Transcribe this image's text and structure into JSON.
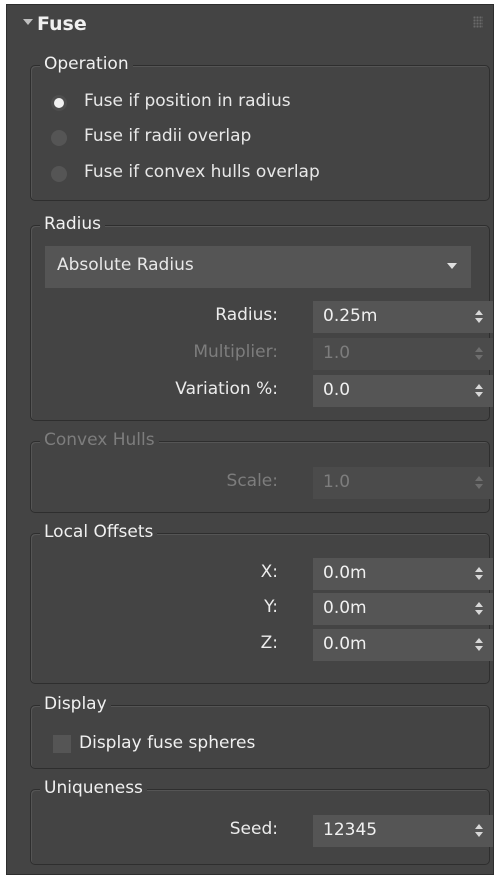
{
  "rollout": {
    "title": "Fuse"
  },
  "operation": {
    "title": "Operation",
    "options": [
      {
        "label": "Fuse if position in radius",
        "selected": true
      },
      {
        "label": "Fuse if radii overlap",
        "selected": false
      },
      {
        "label": "Fuse if convex hulls overlap",
        "selected": false
      }
    ]
  },
  "radius_group": {
    "title": "Radius",
    "mode": "Absolute Radius",
    "radius_label": "Radius:",
    "radius_value": "0.25m",
    "multiplier_label": "Multiplier:",
    "multiplier_value": "1.0",
    "variation_label": "Variation %:",
    "variation_value": "0.0"
  },
  "convex_hulls": {
    "title": "Convex Hulls",
    "scale_label": "Scale:",
    "scale_value": "1.0"
  },
  "local_offsets": {
    "title": "Local Offsets",
    "x_label": "X:",
    "x_value": "0.0m",
    "y_label": "Y:",
    "y_value": "0.0m",
    "z_label": "Z:",
    "z_value": "0.0m"
  },
  "display": {
    "title": "Display",
    "checkbox_label": "Display fuse spheres",
    "checked": false
  },
  "uniqueness": {
    "title": "Uniqueness",
    "seed_label": "Seed:",
    "seed_value": "12345"
  },
  "colors": {
    "panel_bg": "#444444",
    "field_bg": "#555555",
    "text": "#e8e8e8",
    "disabled_text": "#7d7d7d",
    "border": "#2e2e2e"
  }
}
